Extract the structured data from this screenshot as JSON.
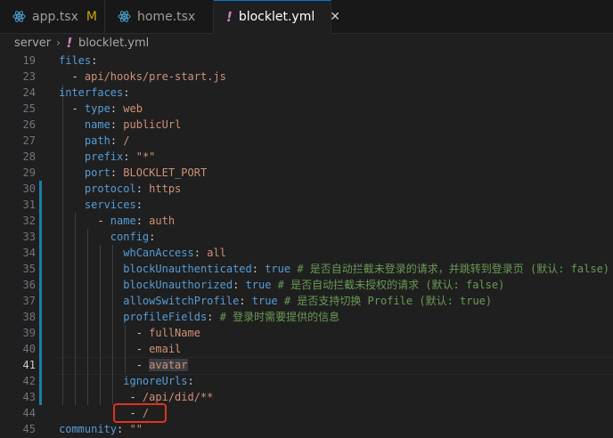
{
  "tabs": [
    {
      "label": "app.tsx",
      "status": "M",
      "icon": "react-icon"
    },
    {
      "label": "home.tsx",
      "icon": "react-icon"
    },
    {
      "label": "blocklet.yml",
      "icon": "yaml-exclamation-icon",
      "active": true
    }
  ],
  "tab_icon_glyph": "!",
  "close_glyph": "✕",
  "breadcrumb": {
    "folder": "server",
    "separator": "›",
    "file_icon": "!",
    "file": "blocklet.yml"
  },
  "editor": {
    "current_line": "41",
    "lines": [
      {
        "n": "19",
        "t": [
          {
            "k": "files"
          },
          {
            "p": ":"
          }
        ]
      },
      {
        "n": "23",
        "t": [
          {
            "p": "  - "
          },
          {
            "v": "api/hooks/pre-start.js"
          }
        ]
      },
      {
        "n": "24",
        "t": [
          {
            "k": "interfaces"
          },
          {
            "p": ":"
          }
        ]
      },
      {
        "n": "25",
        "t": [
          {
            "p": "  - "
          },
          {
            "k": "type"
          },
          {
            "p": ": "
          },
          {
            "v": "web"
          }
        ]
      },
      {
        "n": "26",
        "t": [
          {
            "p": "    "
          },
          {
            "k": "name"
          },
          {
            "p": ": "
          },
          {
            "v": "publicUrl"
          }
        ]
      },
      {
        "n": "27",
        "t": [
          {
            "p": "    "
          },
          {
            "k": "path"
          },
          {
            "p": ": "
          },
          {
            "v": "/"
          }
        ]
      },
      {
        "n": "28",
        "t": [
          {
            "p": "    "
          },
          {
            "k": "prefix"
          },
          {
            "p": ": "
          },
          {
            "v": "\"*\""
          }
        ]
      },
      {
        "n": "29",
        "t": [
          {
            "p": "    "
          },
          {
            "k": "port"
          },
          {
            "p": ": "
          },
          {
            "v": "BLOCKLET_PORT"
          }
        ]
      },
      {
        "n": "30",
        "t": [
          {
            "p": "    "
          },
          {
            "k": "protocol"
          },
          {
            "p": ": "
          },
          {
            "v": "https"
          }
        ]
      },
      {
        "n": "31",
        "t": [
          {
            "p": "    "
          },
          {
            "k": "services"
          },
          {
            "p": ":"
          }
        ]
      },
      {
        "n": "32",
        "t": [
          {
            "p": "      - "
          },
          {
            "k": "name"
          },
          {
            "p": ": "
          },
          {
            "v": "auth"
          }
        ]
      },
      {
        "n": "33",
        "t": [
          {
            "p": "        "
          },
          {
            "k": "config"
          },
          {
            "p": ":"
          }
        ]
      },
      {
        "n": "34",
        "t": [
          {
            "p": "          "
          },
          {
            "k": "whCanAccess"
          },
          {
            "p": ": "
          },
          {
            "v": "all"
          }
        ]
      },
      {
        "n": "35",
        "t": [
          {
            "p": "          "
          },
          {
            "k": "blockUnauthenticated"
          },
          {
            "p": ": "
          },
          {
            "b": "true"
          },
          {
            "c": " # 是否自动拦截未登录的请求，并跳转到登录页 (默认: false)"
          }
        ]
      },
      {
        "n": "36",
        "t": [
          {
            "p": "          "
          },
          {
            "k": "blockUnauthorized"
          },
          {
            "p": ": "
          },
          {
            "b": "true"
          },
          {
            "c": " # 是否自动拦截未授权的请求 (默认: false)"
          }
        ]
      },
      {
        "n": "37",
        "t": [
          {
            "p": "          "
          },
          {
            "k": "allowSwitchProfile"
          },
          {
            "p": ": "
          },
          {
            "b": "true"
          },
          {
            "c": " # 是否支持切换 Profile (默认: true)"
          }
        ]
      },
      {
        "n": "38",
        "t": [
          {
            "p": "          "
          },
          {
            "k": "profileFields"
          },
          {
            "p": ":"
          },
          {
            "c": " # 登录时需要提供的信息"
          }
        ]
      },
      {
        "n": "39",
        "t": [
          {
            "p": "            - "
          },
          {
            "v": "fullName"
          }
        ]
      },
      {
        "n": "40",
        "t": [
          {
            "p": "            - "
          },
          {
            "v": "email"
          }
        ]
      },
      {
        "n": "41",
        "t": [
          {
            "p": "            - "
          },
          {
            "vh": "avatar"
          }
        ]
      },
      {
        "n": "42",
        "t": [
          {
            "p": "          "
          },
          {
            "k": "ignoreUrls"
          },
          {
            "p": ":"
          }
        ]
      },
      {
        "n": "43",
        "t": [
          {
            "p": "           - "
          },
          {
            "v": "/api/did/**"
          }
        ]
      },
      {
        "n": "44",
        "t": [
          {
            "p": "           - "
          },
          {
            "v": "/"
          }
        ]
      },
      {
        "n": "45",
        "t": [
          {
            "k": "community"
          },
          {
            "p": ": "
          },
          {
            "v": "\"\""
          }
        ]
      }
    ]
  },
  "colors": {
    "annotation": "#e0331e",
    "accent": "#0078d4",
    "key": "#569cd6",
    "string": "#ce9178",
    "comment": "#6a9955"
  }
}
